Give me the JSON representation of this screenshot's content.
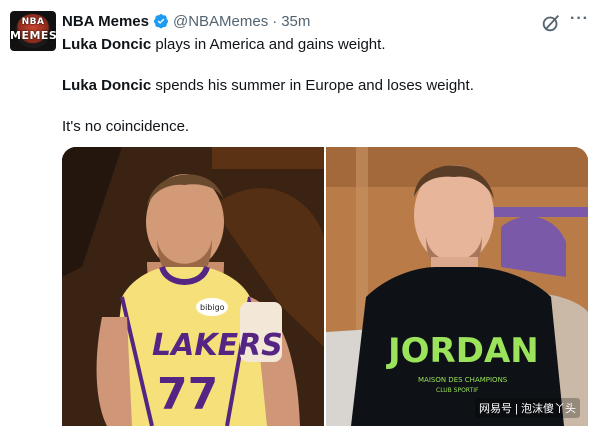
{
  "tweet": {
    "display_name": "NBA Memes",
    "handle": "@NBAMemes",
    "separator": "·",
    "time": "35m",
    "avatar_text_top": "NBA",
    "avatar_text_bottom": "MEMES",
    "line1_name": "Luka Doncic",
    "line1_rest": " plays in America and gains weight.",
    "line2_name": "Luka Doncic",
    "line2_rest": " spends his summer in Europe and loses weight.",
    "line3": "It's no coincidence.",
    "more_label": "···"
  },
  "media": {
    "left": {
      "jersey_text": "LAKERS",
      "jersey_number": "77",
      "patch_text": "bibigo"
    },
    "right": {
      "shirt_text": "JORDAN",
      "shirt_subtext_1": "MAISON DES CHAMPIONS",
      "shirt_subtext_2": "CLUB SPORTIF"
    },
    "watermark": "网易号 | 泡沫傻丫头"
  },
  "colors": {
    "verified": "#1d9bf0",
    "secondary_text": "#536471",
    "lakers_gold": "#f6e27a",
    "lakers_purple": "#552583",
    "jordan_green": "#9be35a"
  },
  "icons": [
    "verified-badge-icon",
    "grok-icon",
    "more-options-icon"
  ]
}
